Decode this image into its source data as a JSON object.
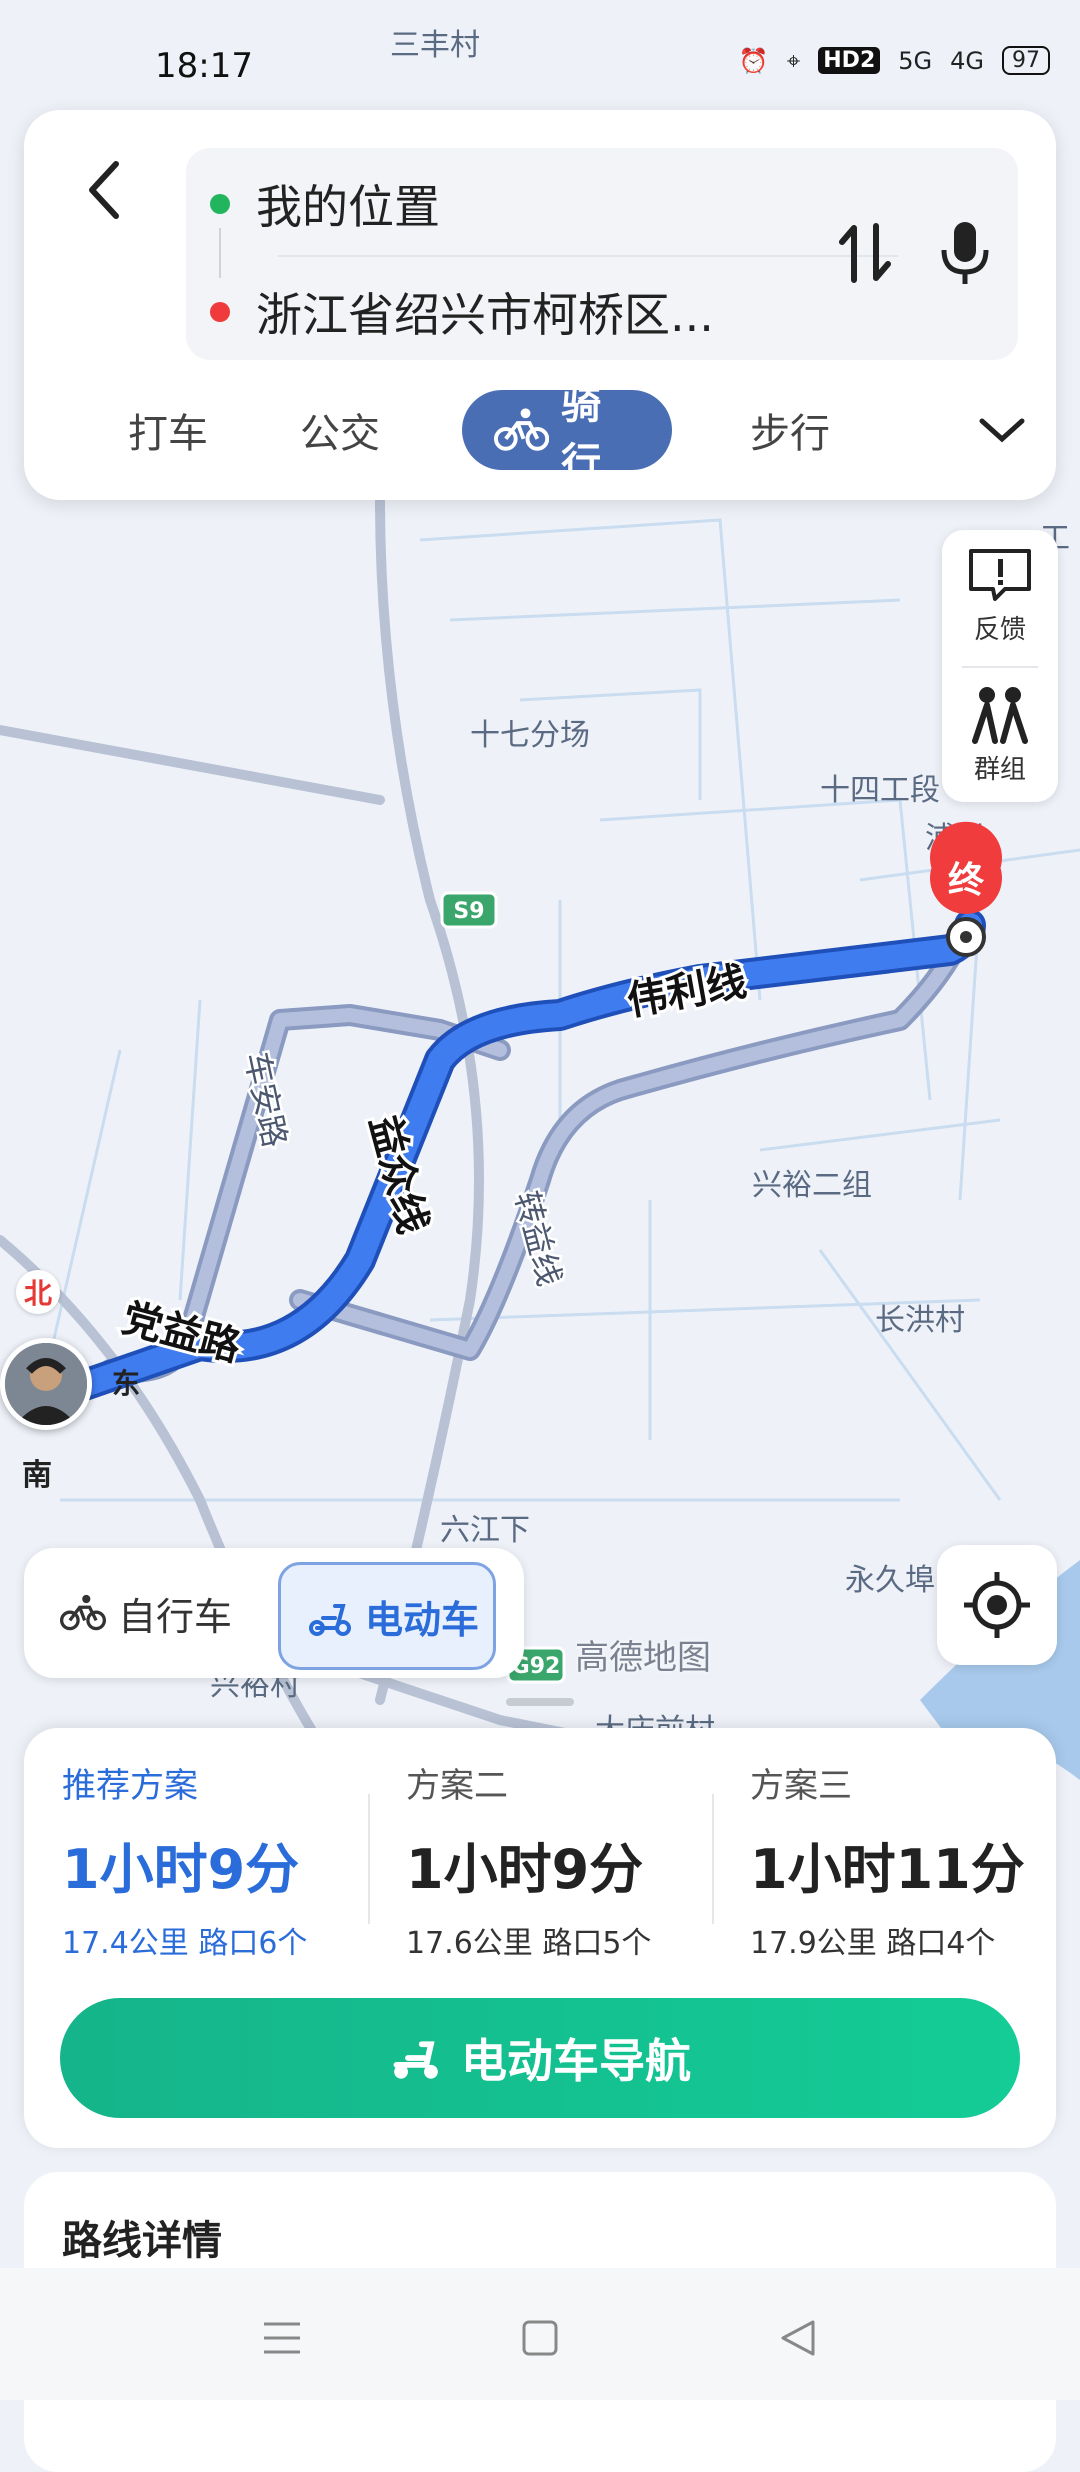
{
  "status_bar": {
    "time": "18:17",
    "network_hd": "HD2",
    "net1": "5G",
    "net2": "4G",
    "battery": "97"
  },
  "route": {
    "origin": "我的位置",
    "destination": "浙江省绍兴市柯桥区..."
  },
  "modes": [
    {
      "label": "打车",
      "active": false
    },
    {
      "label": "公交",
      "active": false
    },
    {
      "label": "骑行",
      "active": true
    },
    {
      "label": "步行",
      "active": false
    }
  ],
  "side_tools": [
    {
      "label": "反馈",
      "icon": "feedback-icon"
    },
    {
      "label": "群组",
      "icon": "group-icon"
    }
  ],
  "map": {
    "place_labels": [
      "三丰村",
      "十七分场",
      "十四工段",
      "浦联",
      "兴裕二组",
      "长洪村",
      "六江下",
      "永久埠",
      "工",
      "大庆前村",
      "兴裕村"
    ],
    "road_labels": [
      "伟利线",
      "益众线",
      "车安路",
      "党益路",
      "转益线"
    ],
    "highway_badges": [
      "S9",
      "G92"
    ],
    "end_marker": "终",
    "compass": {
      "north": "北",
      "south": "南",
      "east": "东"
    }
  },
  "vehicle": {
    "bike": "自行车",
    "ebike": "电动车",
    "selected": "ebike"
  },
  "map_logo": "高德地图",
  "plans": [
    {
      "name": "推荐方案",
      "time": "1小时9分",
      "distance": "17.4公里",
      "junctions": "路口6个",
      "active": true
    },
    {
      "name": "方案二",
      "time": "1小时9分",
      "distance": "17.6公里",
      "junctions": "路口5个",
      "active": false
    },
    {
      "name": "方案三",
      "time": "1小时11分",
      "distance": "17.9公里",
      "junctions": "路口4个",
      "active": false
    }
  ],
  "nav_button": "电动车导航",
  "details_title": "路线详情",
  "colors": {
    "route_primary": "#3a6fe0",
    "route_alt": "#a9b6d3",
    "accent_blue": "#2a6cd9",
    "nav_green": "#14c090",
    "tab_active": "#4a6eb3"
  }
}
